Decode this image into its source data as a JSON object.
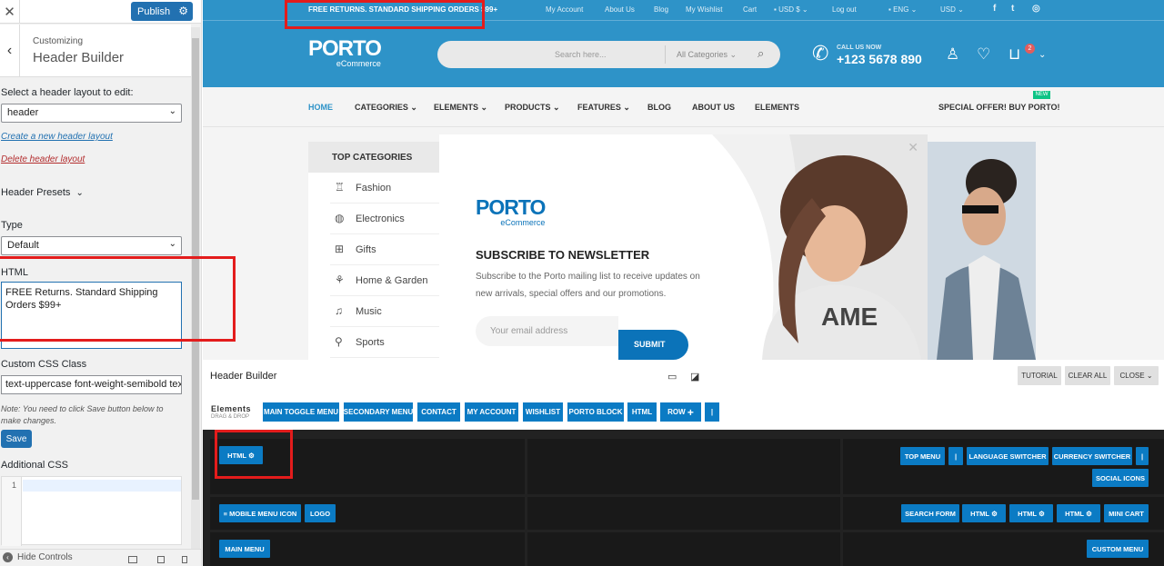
{
  "customizer": {
    "publish_label": "Publish",
    "customizing_label": "Customizing",
    "panel_title": "Header Builder",
    "layout_label": "Select a header layout to edit:",
    "layout_value": "header",
    "create_link": "Create a new header layout",
    "delete_link": "Delete header layout",
    "presets_label": "Header Presets",
    "type_label": "Type",
    "type_value": "Default",
    "html_label": "HTML",
    "html_value": "FREE Returns. Standard Shipping Orders $99+",
    "css_class_label": "Custom CSS Class",
    "css_class_value": "text-uppercase font-weight-semibold text",
    "note": "Note: You need to click Save button below to make changes.",
    "save_label": "Save",
    "additional_css_label": "Additional CSS",
    "line_number": "1",
    "hide_controls_label": "Hide Controls"
  },
  "preview": {
    "topbar": {
      "promo": "FREE RETURNS. STANDARD SHIPPING ORDERS $99+",
      "links": [
        "My Account",
        "About Us",
        "Blog",
        "My Wishlist",
        "Cart"
      ],
      "currency1": "USD $",
      "logout": "Log out",
      "language": "ENG",
      "currency2": "USD",
      "social_icons": [
        "facebook-icon",
        "twitter-icon",
        "instagram-icon"
      ]
    },
    "logo_text": "PORTO",
    "logo_sub": "eCommerce",
    "search_placeholder": "Search here...",
    "search_category": "All Categories",
    "call_label": "CALL US NOW",
    "phone": "+123 5678 890",
    "cart_count": "2",
    "nav": [
      "HOME",
      "CATEGORIES",
      "ELEMENTS",
      "PRODUCTS",
      "FEATURES",
      "BLOG",
      "ABOUT US",
      "ELEMENTS"
    ],
    "nav_special": "SPECIAL OFFER! BUY PORTO!",
    "nav_new_badge": "NEW",
    "top_categories_title": "TOP CATEGORIES",
    "categories": [
      "Fashion",
      "Electronics",
      "Gifts",
      "Home & Garden",
      "Music",
      "Sports"
    ],
    "popup": {
      "logo": "PORTO",
      "logo_sub": "eCommerce",
      "title": "SUBSCRIBE TO NEWSLETTER",
      "description": "Subscribe to the Porto mailing list to receive updates on new arrivals, special offers and our promotions.",
      "email_placeholder": "Your email address",
      "submit_label": "SUBMIT"
    }
  },
  "builder": {
    "title": "Header Builder",
    "tutorial_label": "TUTORIAL",
    "clear_all_label": "CLEAR ALL",
    "close_label": "CLOSE",
    "elements_label": "Elements",
    "drag_drop_label": "DRAG & DROP",
    "element_buttons": [
      "MAIN TOGGLE MENU",
      "SECONDARY MENU",
      "CONTACT",
      "MY ACCOUNT",
      "WISHLIST",
      "PORTO BLOCK",
      "HTML",
      "ROW",
      "|"
    ],
    "row1_left": [
      "HTML"
    ],
    "row1_right": [
      "TOP MENU",
      "|",
      "LANGUAGE SWITCHER",
      "CURRENCY SWITCHER",
      "|",
      "SOCIAL ICONS"
    ],
    "row2_left": [
      "MOBILE MENU ICON",
      "LOGO"
    ],
    "row2_right": [
      "SEARCH FORM",
      "HTML",
      "HTML",
      "HTML",
      "MINI CART"
    ],
    "row3_left": [
      "MAIN MENU"
    ],
    "row3_right": [
      "CUSTOM MENU"
    ]
  },
  "colors": {
    "brand_blue": "#2e93c8",
    "button_blue": "#0b7bc4",
    "highlight_red": "#e31c1c",
    "wp_blue": "#2271b1"
  }
}
